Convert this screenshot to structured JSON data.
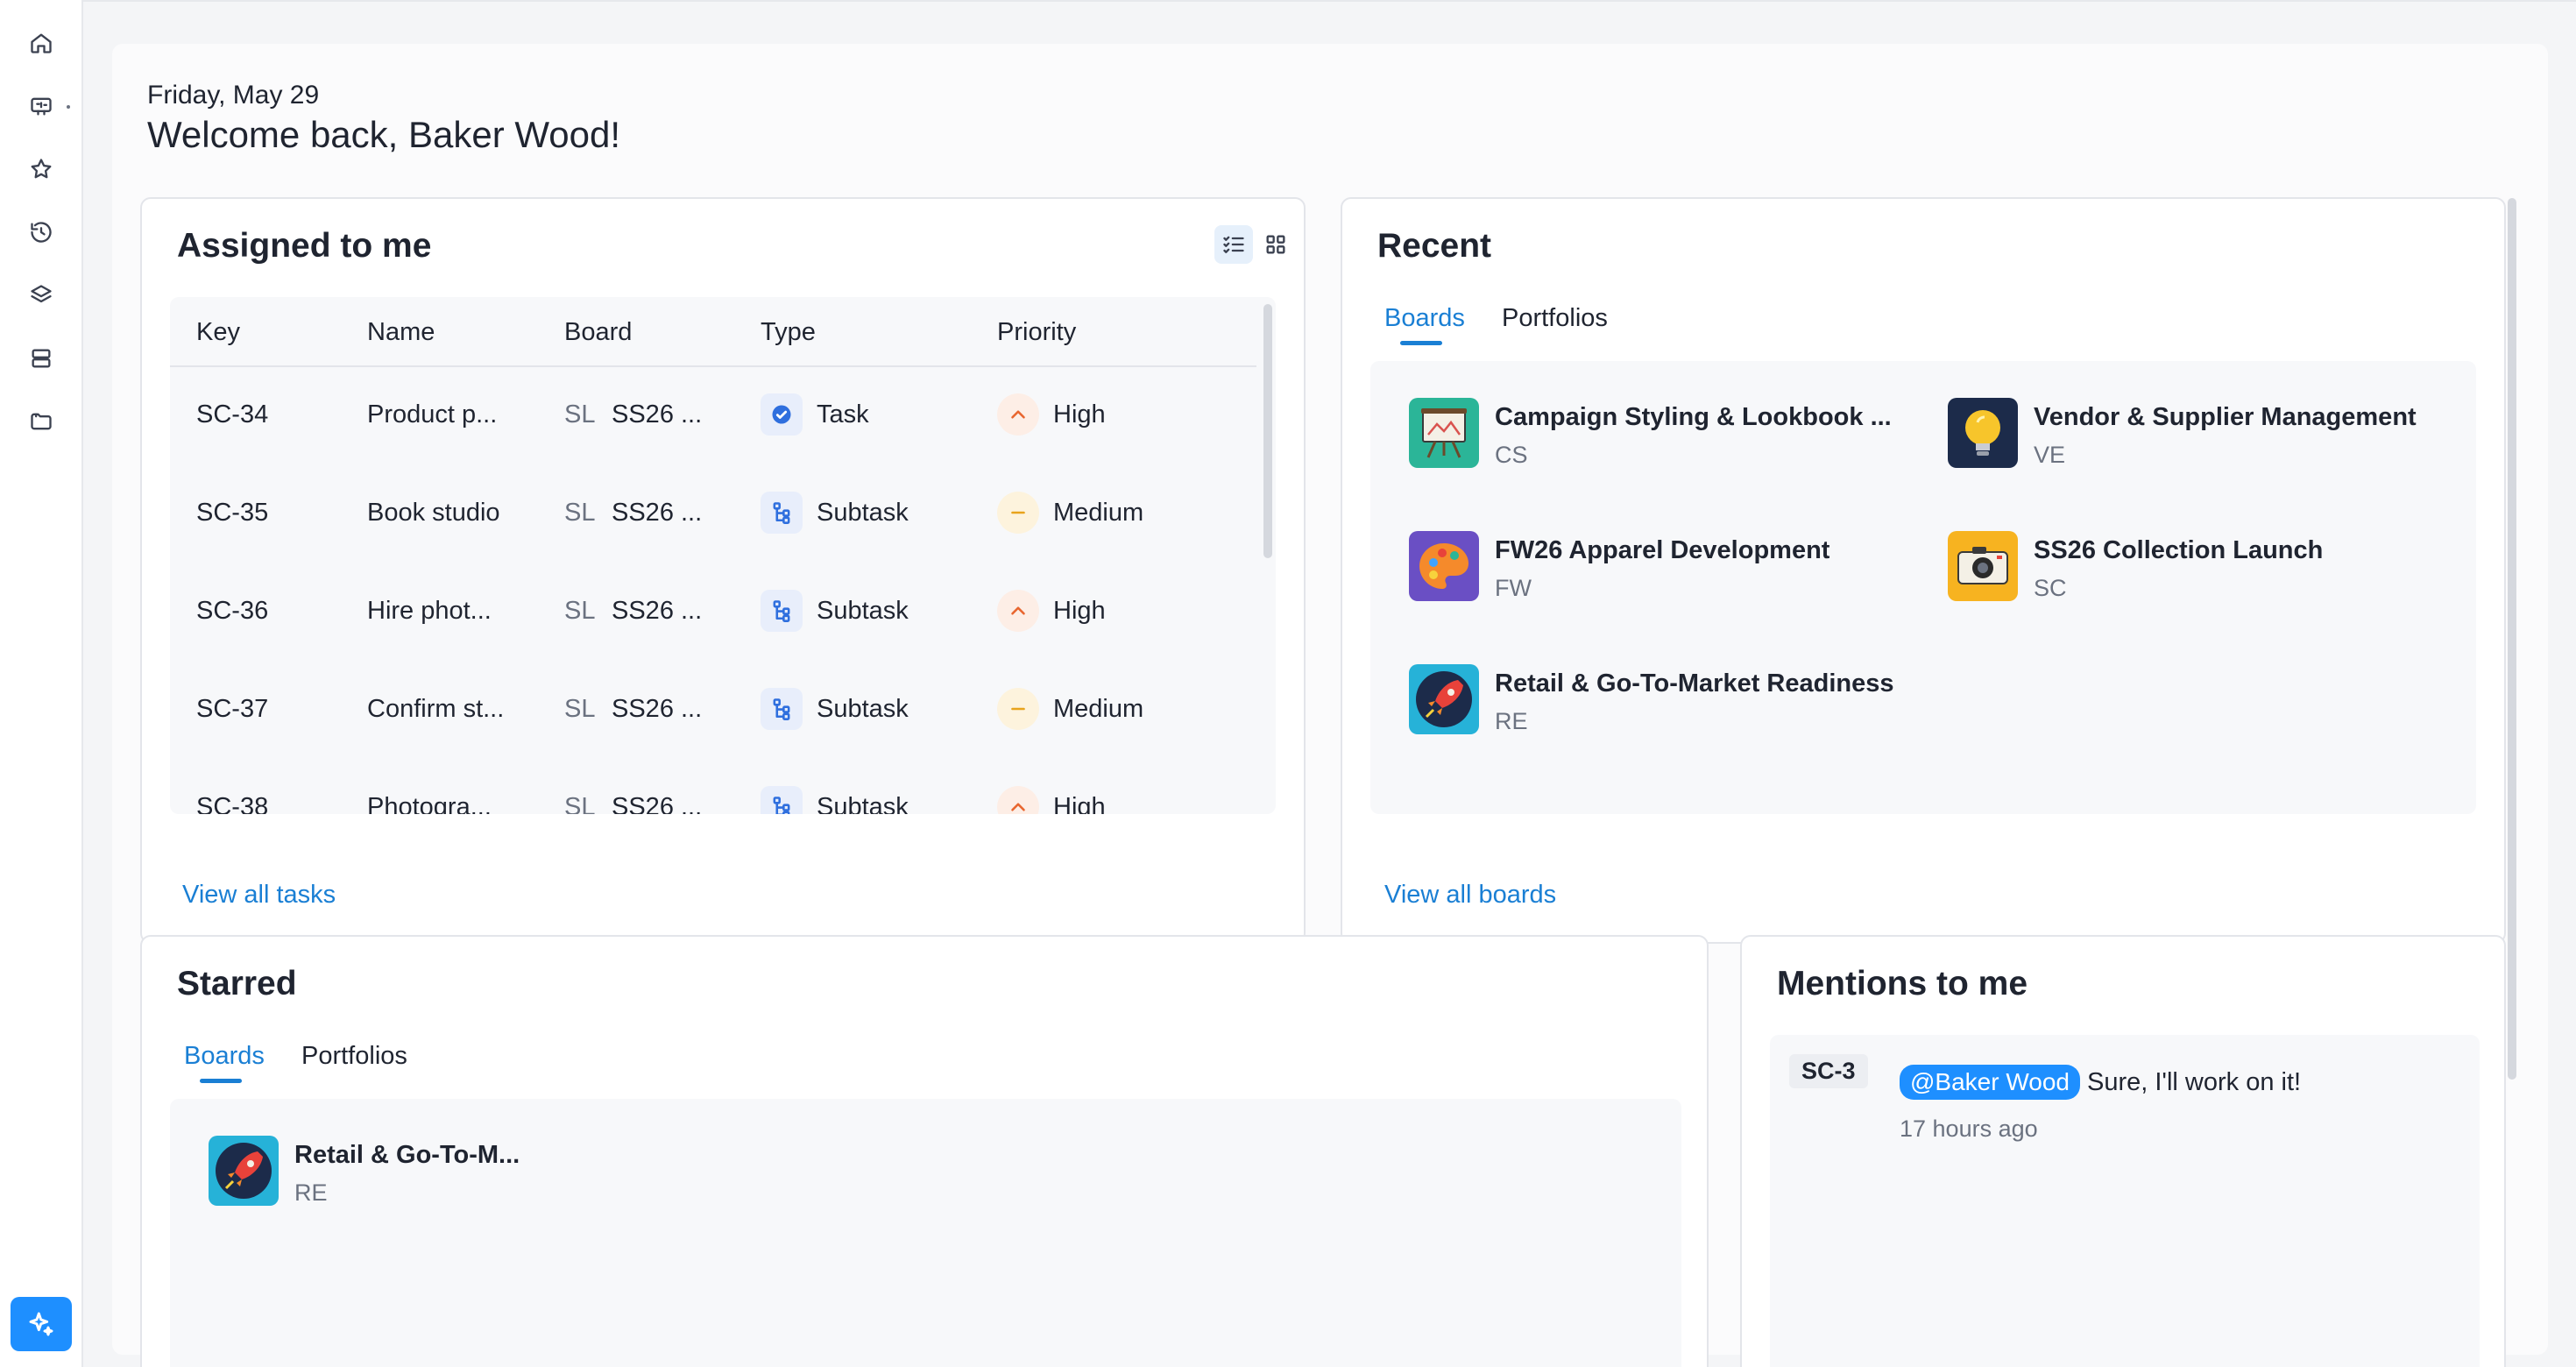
{
  "header": {
    "date": "Friday, May 29",
    "welcome": "Welcome back, Baker Wood!"
  },
  "sidebar": {
    "items": [
      {
        "icon": "home-icon"
      },
      {
        "icon": "board-icon"
      },
      {
        "icon": "star-icon"
      },
      {
        "icon": "history-icon"
      },
      {
        "icon": "layers-icon"
      },
      {
        "icon": "storage-icon"
      },
      {
        "icon": "folder-icon"
      }
    ],
    "ai_button_icon": "sparkle-icon"
  },
  "assigned": {
    "title": "Assigned to me",
    "columns": [
      "Key",
      "Name",
      "Board",
      "Type",
      "Priority"
    ],
    "rows": [
      {
        "key": "SC-34",
        "name": "Product p...",
        "board_code": "SL",
        "board": "SS26 ...",
        "type": "Task",
        "priority": "High"
      },
      {
        "key": "SC-35",
        "name": "Book studio",
        "board_code": "SL",
        "board": "SS26 ...",
        "type": "Subtask",
        "priority": "Medium"
      },
      {
        "key": "SC-36",
        "name": "Hire phot...",
        "board_code": "SL",
        "board": "SS26 ...",
        "type": "Subtask",
        "priority": "High"
      },
      {
        "key": "SC-37",
        "name": "Confirm st...",
        "board_code": "SL",
        "board": "SS26 ...",
        "type": "Subtask",
        "priority": "Medium"
      },
      {
        "key": "SC-38",
        "name": "Photogra...",
        "board_code": "SL",
        "board": "SS26 ...",
        "type": "Subtask",
        "priority": "High"
      }
    ],
    "view_all": "View all tasks"
  },
  "recent": {
    "title": "Recent",
    "tabs": [
      "Boards",
      "Portfolios"
    ],
    "boards": [
      {
        "name": "Campaign Styling & Lookbook ...",
        "code": "CS",
        "icon": "easel-icon"
      },
      {
        "name": "Vendor & Supplier Management",
        "code": "VE",
        "icon": "lightbulb-icon"
      },
      {
        "name": "FW26 Apparel Development",
        "code": "FW",
        "icon": "palette-icon"
      },
      {
        "name": "SS26 Collection Launch",
        "code": "SC",
        "icon": "camera-icon"
      },
      {
        "name": "Retail & Go-To-Market Readiness",
        "code": "RE",
        "icon": "rocket-icon"
      }
    ],
    "view_all": "View all boards"
  },
  "starred": {
    "title": "Starred",
    "tabs": [
      "Boards",
      "Portfolios"
    ],
    "boards": [
      {
        "name": "Retail & Go-To-M...",
        "code": "RE",
        "icon": "rocket-icon"
      }
    ]
  },
  "mentions": {
    "title": "Mentions to me",
    "items": [
      {
        "key": "SC-3",
        "mention": "@Baker Wood",
        "text": "Sure, I'll work on it!",
        "time": "17 hours ago"
      }
    ]
  },
  "colors": {
    "accent": "#1e8fff",
    "link": "#1a7fd4",
    "priority_high": "#e8662f",
    "priority_medium": "#e8a31c"
  }
}
